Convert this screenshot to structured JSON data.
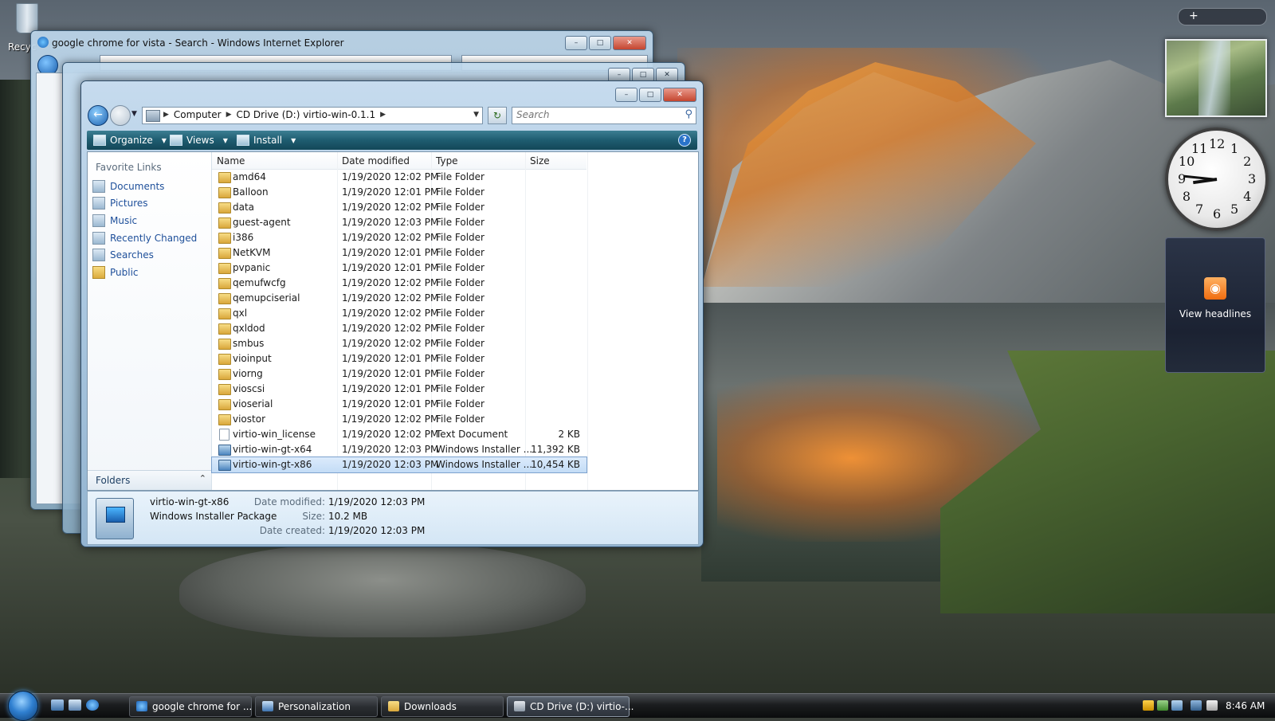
{
  "desktop": {
    "recycle_label": "Recyc"
  },
  "ie_window": {
    "title": "google chrome for vista - Search - Windows Internet Explorer"
  },
  "explorer": {
    "breadcrumb": [
      "Computer",
      "CD Drive (D:) virtio-win-0.1.1"
    ],
    "search_placeholder": "Search",
    "commands": {
      "organize": "Organize",
      "views": "Views",
      "install": "Install"
    },
    "nav_pane": {
      "header": "Favorite Links",
      "links": [
        "Documents",
        "Pictures",
        "Music",
        "Recently Changed",
        "Searches",
        "Public"
      ],
      "folders_label": "Folders"
    },
    "columns": {
      "name": "Name",
      "date": "Date modified",
      "type": "Type",
      "size": "Size"
    },
    "files": [
      {
        "name": "amd64",
        "date": "1/19/2020 12:02 PM",
        "type": "File Folder",
        "size": "",
        "icon": "folder"
      },
      {
        "name": "Balloon",
        "date": "1/19/2020 12:01 PM",
        "type": "File Folder",
        "size": "",
        "icon": "folder"
      },
      {
        "name": "data",
        "date": "1/19/2020 12:02 PM",
        "type": "File Folder",
        "size": "",
        "icon": "folder"
      },
      {
        "name": "guest-agent",
        "date": "1/19/2020 12:03 PM",
        "type": "File Folder",
        "size": "",
        "icon": "folder"
      },
      {
        "name": "i386",
        "date": "1/19/2020 12:02 PM",
        "type": "File Folder",
        "size": "",
        "icon": "folder"
      },
      {
        "name": "NetKVM",
        "date": "1/19/2020 12:01 PM",
        "type": "File Folder",
        "size": "",
        "icon": "folder"
      },
      {
        "name": "pvpanic",
        "date": "1/19/2020 12:01 PM",
        "type": "File Folder",
        "size": "",
        "icon": "folder"
      },
      {
        "name": "qemufwcfg",
        "date": "1/19/2020 12:02 PM",
        "type": "File Folder",
        "size": "",
        "icon": "folder"
      },
      {
        "name": "qemupciserial",
        "date": "1/19/2020 12:02 PM",
        "type": "File Folder",
        "size": "",
        "icon": "folder"
      },
      {
        "name": "qxl",
        "date": "1/19/2020 12:02 PM",
        "type": "File Folder",
        "size": "",
        "icon": "folder"
      },
      {
        "name": "qxldod",
        "date": "1/19/2020 12:02 PM",
        "type": "File Folder",
        "size": "",
        "icon": "folder"
      },
      {
        "name": "smbus",
        "date": "1/19/2020 12:02 PM",
        "type": "File Folder",
        "size": "",
        "icon": "folder"
      },
      {
        "name": "vioinput",
        "date": "1/19/2020 12:01 PM",
        "type": "File Folder",
        "size": "",
        "icon": "folder"
      },
      {
        "name": "viorng",
        "date": "1/19/2020 12:01 PM",
        "type": "File Folder",
        "size": "",
        "icon": "folder"
      },
      {
        "name": "vioscsi",
        "date": "1/19/2020 12:01 PM",
        "type": "File Folder",
        "size": "",
        "icon": "folder"
      },
      {
        "name": "vioserial",
        "date": "1/19/2020 12:01 PM",
        "type": "File Folder",
        "size": "",
        "icon": "folder"
      },
      {
        "name": "viostor",
        "date": "1/19/2020 12:02 PM",
        "type": "File Folder",
        "size": "",
        "icon": "folder"
      },
      {
        "name": "virtio-win_license",
        "date": "1/19/2020 12:02 PM",
        "type": "Text Document",
        "size": "2 KB",
        "icon": "doc"
      },
      {
        "name": "virtio-win-gt-x64",
        "date": "1/19/2020 12:03 PM",
        "type": "Windows Installer ...",
        "size": "11,392 KB",
        "icon": "msi"
      },
      {
        "name": "virtio-win-gt-x86",
        "date": "1/19/2020 12:03 PM",
        "type": "Windows Installer ...",
        "size": "10,454 KB",
        "icon": "msi",
        "selected": true
      }
    ],
    "details": {
      "name": "virtio-win-gt-x86",
      "kind": "Windows Installer Package",
      "date_modified_label": "Date modified:",
      "date_modified": "1/19/2020 12:03 PM",
      "size_label": "Size:",
      "size": "10.2 MB",
      "date_created_label": "Date created:",
      "date_created": "1/19/2020 12:03 PM"
    }
  },
  "gadgets": {
    "rss_label": "View headlines",
    "clock_numbers": [
      "12",
      "1",
      "2",
      "3",
      "4",
      "5",
      "6",
      "7",
      "8",
      "9",
      "10",
      "11"
    ]
  },
  "taskbar": {
    "buttons": [
      {
        "label": "google chrome for ...",
        "icon": "ie-icon"
      },
      {
        "label": "Personalization",
        "icon": "personalization-icon"
      },
      {
        "label": "Downloads",
        "icon": "folder-icon"
      },
      {
        "label": "CD Drive (D:) virtio-...",
        "icon": "cd-drive-icon",
        "active": true
      }
    ],
    "time": "8:46 AM"
  }
}
